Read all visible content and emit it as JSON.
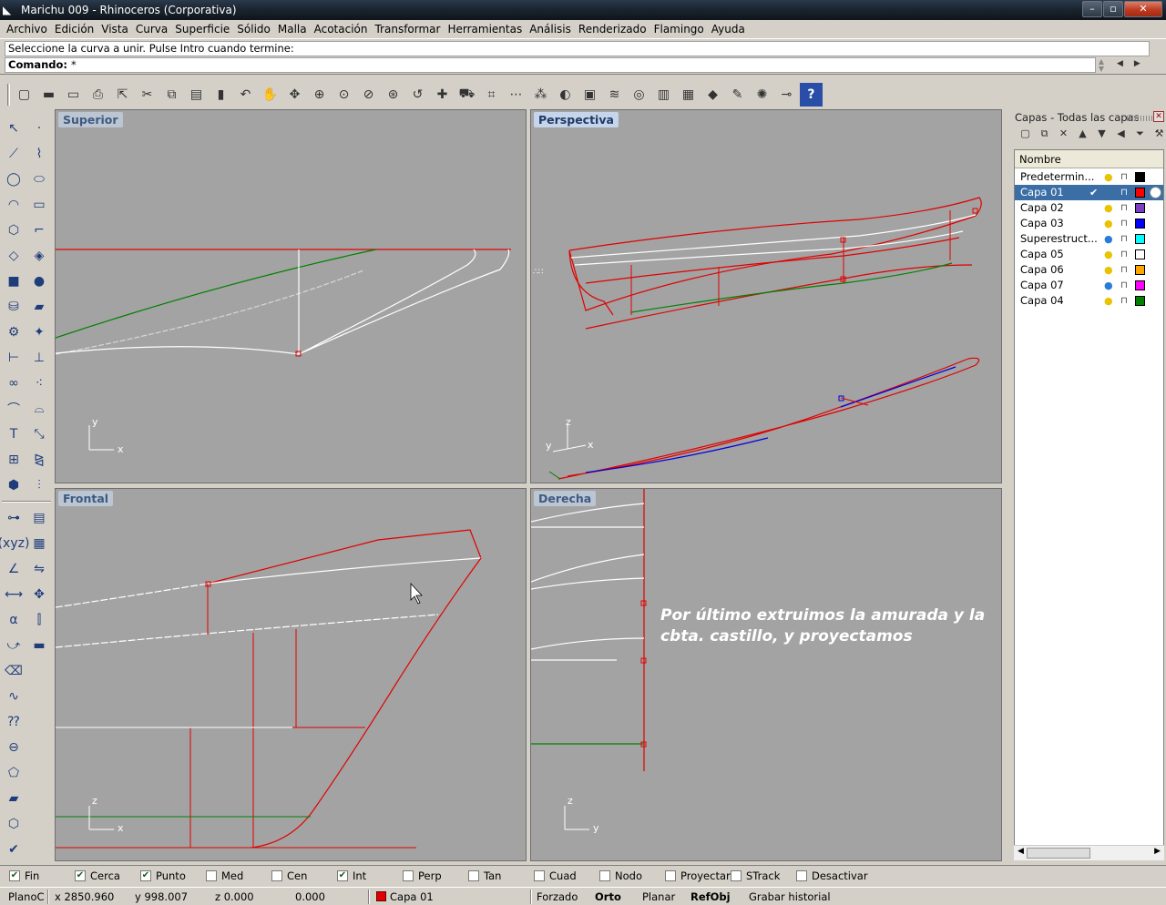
{
  "window": {
    "title": "Marichu 009 - Rhinoceros (Corporativa)",
    "minimize": "–",
    "maximize": "▫",
    "close": "✕"
  },
  "menu": [
    "Archivo",
    "Edición",
    "Vista",
    "Curva",
    "Superficie",
    "Sólido",
    "Malla",
    "Acotación",
    "Transformar",
    "Herramientas",
    "Análisis",
    "Renderizado",
    "Flamingo",
    "Ayuda"
  ],
  "command": {
    "history": "Seleccione la curva a unir. Pulse Intro cuando termine:",
    "prompt_label": "Comando:",
    "prompt_value": "*"
  },
  "viewports": {
    "top": {
      "title": "Superior",
      "axis_v": "y",
      "axis_h": "x"
    },
    "perspective": {
      "title": "Perspectiva",
      "axis_z": "z",
      "axis_y": "y",
      "axis_x": "x"
    },
    "front": {
      "title": "Frontal",
      "axis_v": "z",
      "axis_h": "x"
    },
    "right": {
      "title": "Derecha",
      "axis_v": "z",
      "axis_h": "y",
      "annotation_1": "Por último extruimos la amurada y la",
      "annotation_2": "cbta. castillo, y proyectamos"
    }
  },
  "layers_panel": {
    "title": "Capas - Todas las capas",
    "column_name": "Nombre",
    "layers": [
      {
        "name": "Predetermin...",
        "color": "#000000",
        "current": false,
        "bulb": "yellow"
      },
      {
        "name": "Capa 01",
        "color": "#ff0000",
        "current": true,
        "bulb": "none"
      },
      {
        "name": "Capa 02",
        "color": "#7b3fbf",
        "current": false,
        "bulb": "yellow"
      },
      {
        "name": "Capa 03",
        "color": "#0000ff",
        "current": false,
        "bulb": "yellow"
      },
      {
        "name": "Superestruct...",
        "color": "#00ffff",
        "current": false,
        "bulb": "blue"
      },
      {
        "name": "Capa 05",
        "color": "#ffffff",
        "current": false,
        "bulb": "yellow"
      },
      {
        "name": "Capa 06",
        "color": "#ffa500",
        "current": false,
        "bulb": "yellow"
      },
      {
        "name": "Capa 07",
        "color": "#ff00ff",
        "current": false,
        "bulb": "blue"
      },
      {
        "name": "Capa 04",
        "color": "#008000",
        "current": false,
        "bulb": "yellow"
      }
    ]
  },
  "osnaps": [
    {
      "label": "Fin",
      "checked": true
    },
    {
      "label": "Cerca",
      "checked": true
    },
    {
      "label": "Punto",
      "checked": true
    },
    {
      "label": "Med",
      "checked": false
    },
    {
      "label": "Cen",
      "checked": false
    },
    {
      "label": "Int",
      "checked": true
    },
    {
      "label": "Perp",
      "checked": false
    },
    {
      "label": "Tan",
      "checked": false
    },
    {
      "label": "Cuad",
      "checked": false
    },
    {
      "label": "Nodo",
      "checked": false
    },
    {
      "label": "Proyectar",
      "checked": false
    },
    {
      "label": "STrack",
      "checked": false
    },
    {
      "label": "Desactivar",
      "checked": false
    }
  ],
  "status": {
    "cplane": "PlanoC",
    "x": "x 2850.960",
    "y": "y 998.007",
    "z": "z 0.000",
    "dist": "0.000",
    "layer": "Capa 01",
    "forzado": "Forzado",
    "orto": "Orto",
    "planar": "Planar",
    "refobj": "RefObj",
    "history": "Grabar historial"
  },
  "colors": {
    "curve_red": "#e00000",
    "curve_white": "#ffffff",
    "curve_green": "#008000",
    "curve_blue": "#0000e0",
    "viewport_bg": "#a3a3a3",
    "selection": "#3a6ea5"
  }
}
